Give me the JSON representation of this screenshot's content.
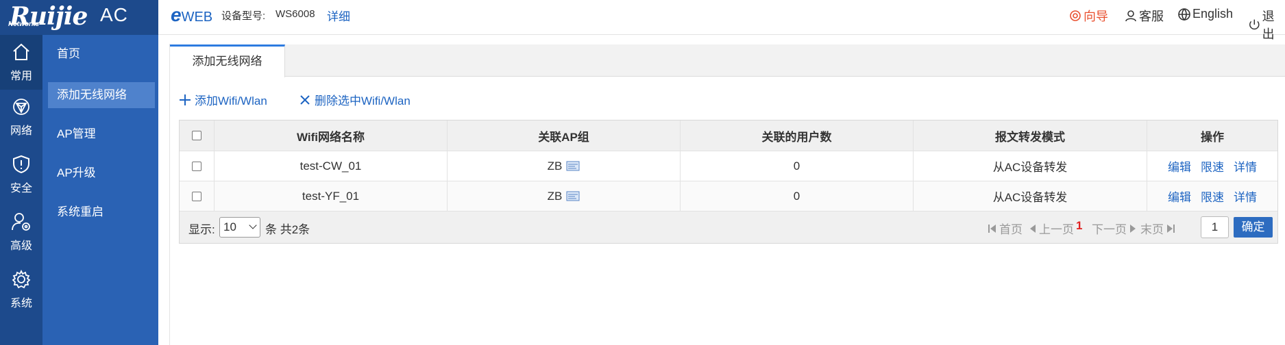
{
  "brand": {
    "logo": "Ruijie",
    "logo_sub": "Networks",
    "product": "AC"
  },
  "rail": [
    {
      "label": "常用",
      "icon": "home-icon"
    },
    {
      "label": "网络",
      "icon": "network-icon"
    },
    {
      "label": "安全",
      "icon": "shield-icon"
    },
    {
      "label": "高级",
      "icon": "user-gear-icon"
    },
    {
      "label": "系统",
      "icon": "gear-icon"
    }
  ],
  "submenu": [
    "首页",
    "添加无线网络",
    "AP管理",
    "AP升级",
    "系统重启"
  ],
  "header": {
    "eweb_e": "e",
    "eweb_text": "WEB",
    "model_label": "设备型号:",
    "model_value": "WS6008",
    "detail": "详细",
    "guide": "向导",
    "service": "客服",
    "language": "English",
    "logout": "退出"
  },
  "tab": "添加无线网络",
  "toolbar": {
    "add": "添加Wifi/Wlan",
    "delete": "删除选中Wifi/Wlan"
  },
  "table": {
    "headers": [
      "Wifi网络名称",
      "关联AP组",
      "关联的用户数",
      "报文转发模式",
      "操作"
    ],
    "rows": [
      {
        "name": "test-CW_01",
        "ap_group": "ZB",
        "users": "0",
        "mode": "从AC设备转发"
      },
      {
        "name": "test-YF_01",
        "ap_group": "ZB",
        "users": "0",
        "mode": "从AC设备转发"
      }
    ],
    "ops": {
      "edit": "编辑",
      "limit": "限速",
      "detail": "详情"
    }
  },
  "pager": {
    "show": "显示:",
    "page_size": "10",
    "unit_total": "条 共2条",
    "first": "首页",
    "prev": "上一页",
    "current": "1",
    "next": "下一页",
    "last": "末页",
    "goto": "1",
    "confirm": "确定"
  },
  "colors": {
    "rail": "#1d4a8c",
    "submenu": "#2a62b4",
    "submenu_active": "#4f82cc",
    "link": "#1d64c2",
    "guide": "#e9502f"
  }
}
